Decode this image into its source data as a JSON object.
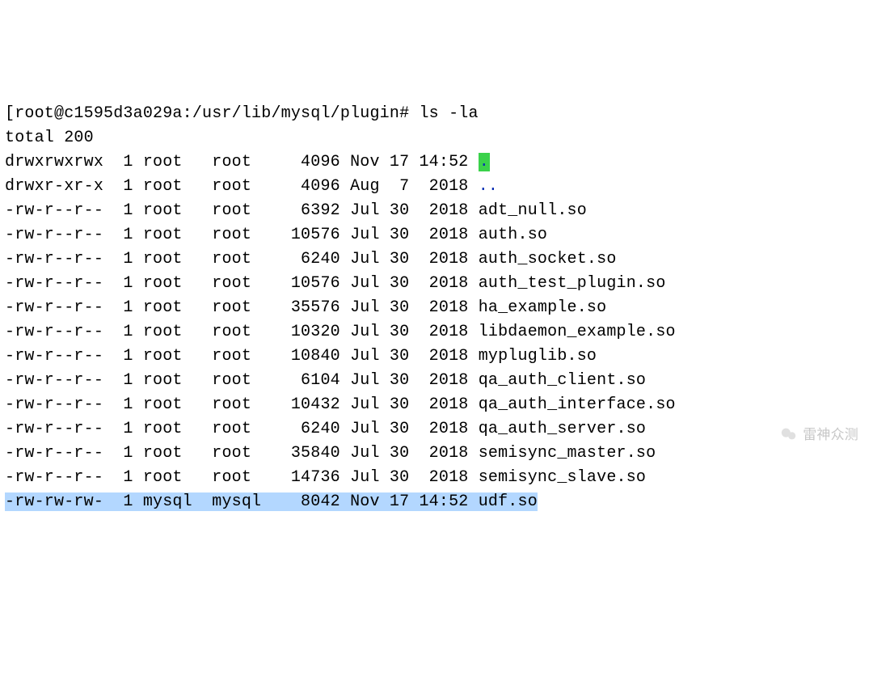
{
  "prompt": "[root@c1595d3a029a:/usr/lib/mysql/plugin# ls -la",
  "total_line": "total 200",
  "rows": [
    {
      "perms": "drwxrwxrwx",
      "links": "1",
      "owner": "root",
      "group": "root",
      "size": "4096",
      "month": "Nov",
      "day": "17",
      "time": "14:52",
      "name": ".",
      "kind": "dir-current"
    },
    {
      "perms": "drwxr-xr-x",
      "links": "1",
      "owner": "root",
      "group": "root",
      "size": "4096",
      "month": "Aug",
      "day": "7",
      "time": "2018",
      "name": "..",
      "kind": "dir-parent"
    },
    {
      "perms": "-rw-r--r--",
      "links": "1",
      "owner": "root",
      "group": "root",
      "size": "6392",
      "month": "Jul",
      "day": "30",
      "time": "2018",
      "name": "adt_null.so",
      "kind": "file"
    },
    {
      "perms": "-rw-r--r--",
      "links": "1",
      "owner": "root",
      "group": "root",
      "size": "10576",
      "month": "Jul",
      "day": "30",
      "time": "2018",
      "name": "auth.so",
      "kind": "file"
    },
    {
      "perms": "-rw-r--r--",
      "links": "1",
      "owner": "root",
      "group": "root",
      "size": "6240",
      "month": "Jul",
      "day": "30",
      "time": "2018",
      "name": "auth_socket.so",
      "kind": "file"
    },
    {
      "perms": "-rw-r--r--",
      "links": "1",
      "owner": "root",
      "group": "root",
      "size": "10576",
      "month": "Jul",
      "day": "30",
      "time": "2018",
      "name": "auth_test_plugin.so",
      "kind": "file"
    },
    {
      "perms": "-rw-r--r--",
      "links": "1",
      "owner": "root",
      "group": "root",
      "size": "35576",
      "month": "Jul",
      "day": "30",
      "time": "2018",
      "name": "ha_example.so",
      "kind": "file"
    },
    {
      "perms": "-rw-r--r--",
      "links": "1",
      "owner": "root",
      "group": "root",
      "size": "10320",
      "month": "Jul",
      "day": "30",
      "time": "2018",
      "name": "libdaemon_example.so",
      "kind": "file"
    },
    {
      "perms": "-rw-r--r--",
      "links": "1",
      "owner": "root",
      "group": "root",
      "size": "10840",
      "month": "Jul",
      "day": "30",
      "time": "2018",
      "name": "mypluglib.so",
      "kind": "file"
    },
    {
      "perms": "-rw-r--r--",
      "links": "1",
      "owner": "root",
      "group": "root",
      "size": "6104",
      "month": "Jul",
      "day": "30",
      "time": "2018",
      "name": "qa_auth_client.so",
      "kind": "file"
    },
    {
      "perms": "-rw-r--r--",
      "links": "1",
      "owner": "root",
      "group": "root",
      "size": "10432",
      "month": "Jul",
      "day": "30",
      "time": "2018",
      "name": "qa_auth_interface.so",
      "kind": "file"
    },
    {
      "perms": "-rw-r--r--",
      "links": "1",
      "owner": "root",
      "group": "root",
      "size": "6240",
      "month": "Jul",
      "day": "30",
      "time": "2018",
      "name": "qa_auth_server.so",
      "kind": "file"
    },
    {
      "perms": "-rw-r--r--",
      "links": "1",
      "owner": "root",
      "group": "root",
      "size": "35840",
      "month": "Jul",
      "day": "30",
      "time": "2018",
      "name": "semisync_master.so",
      "kind": "file"
    },
    {
      "perms": "-rw-r--r--",
      "links": "1",
      "owner": "root",
      "group": "root",
      "size": "14736",
      "month": "Jul",
      "day": "30",
      "time": "2018",
      "name": "semisync_slave.so",
      "kind": "file"
    },
    {
      "perms": "-rw-rw-rw-",
      "links": "1",
      "owner": "mysql",
      "group": "mysql",
      "size": "8042",
      "month": "Nov",
      "day": "17",
      "time": "14:52",
      "name": "udf.so",
      "kind": "file",
      "highlight": true
    }
  ],
  "watermark": "雷神众测"
}
